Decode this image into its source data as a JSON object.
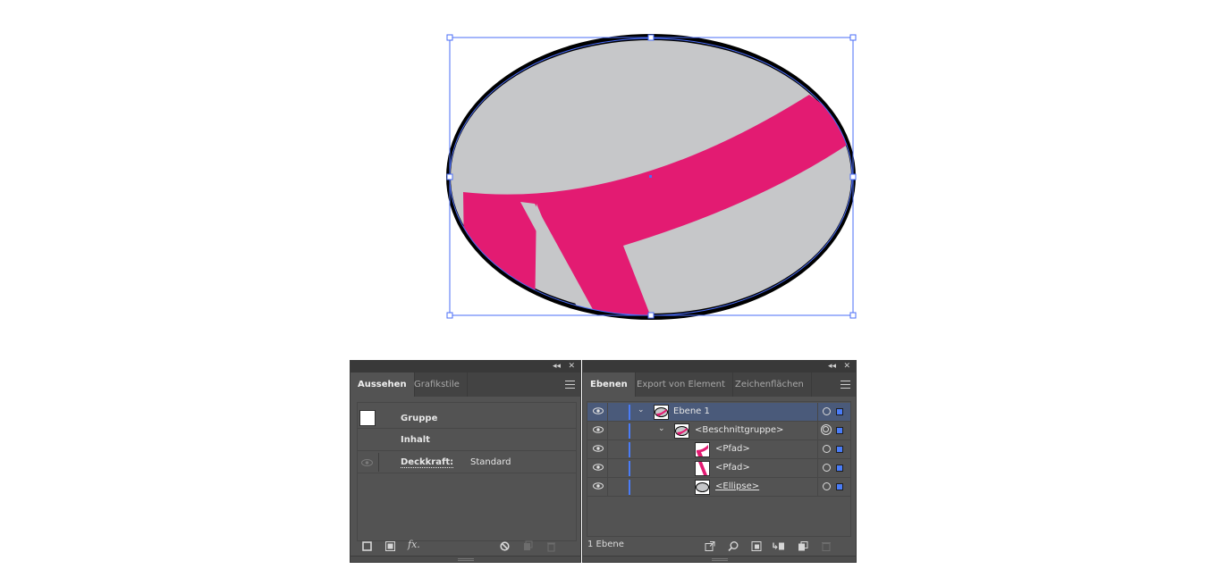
{
  "appearance_panel": {
    "tabs": [
      {
        "label": "Aussehen",
        "active": true
      },
      {
        "label": "Grafikstile",
        "active": false
      }
    ],
    "rows": {
      "group": "Gruppe",
      "content": "Inhalt",
      "opacity_label": "Deckkraft:",
      "opacity_value": "Standard"
    },
    "footer_icons": [
      "new-stroke-icon",
      "new-fill-icon",
      "fx-icon",
      "clear-appearance-icon",
      "duplicate-item-icon",
      "delete-item-icon"
    ],
    "fx_label": "fx."
  },
  "layers_panel": {
    "tabs": [
      {
        "label": "Ebenen",
        "active": true
      },
      {
        "label": "Export von Element",
        "active": false
      },
      {
        "label": "Zeichenflächen",
        "active": false
      }
    ],
    "layers": [
      {
        "name": "Ebene 1",
        "expanded": true,
        "selected": true
      },
      {
        "name": "<Beschnittgruppe>",
        "expanded": true
      },
      {
        "name": "<Pfad>"
      },
      {
        "name": "<Pfad>"
      },
      {
        "name": "<Ellipse>"
      }
    ],
    "status": "1 Ebene",
    "footer_icons": [
      "export-icon",
      "search-icon",
      "make-clipping-mask-icon",
      "create-sublayer-icon",
      "new-layer-icon",
      "delete-layer-icon"
    ]
  },
  "colors": {
    "panel_bg": "#535353",
    "selection_blue": "#4a7cf7",
    "magenta": "#e31b72",
    "ellipse_fill": "#c6c7c9",
    "ellipse_stroke": "#000000"
  }
}
